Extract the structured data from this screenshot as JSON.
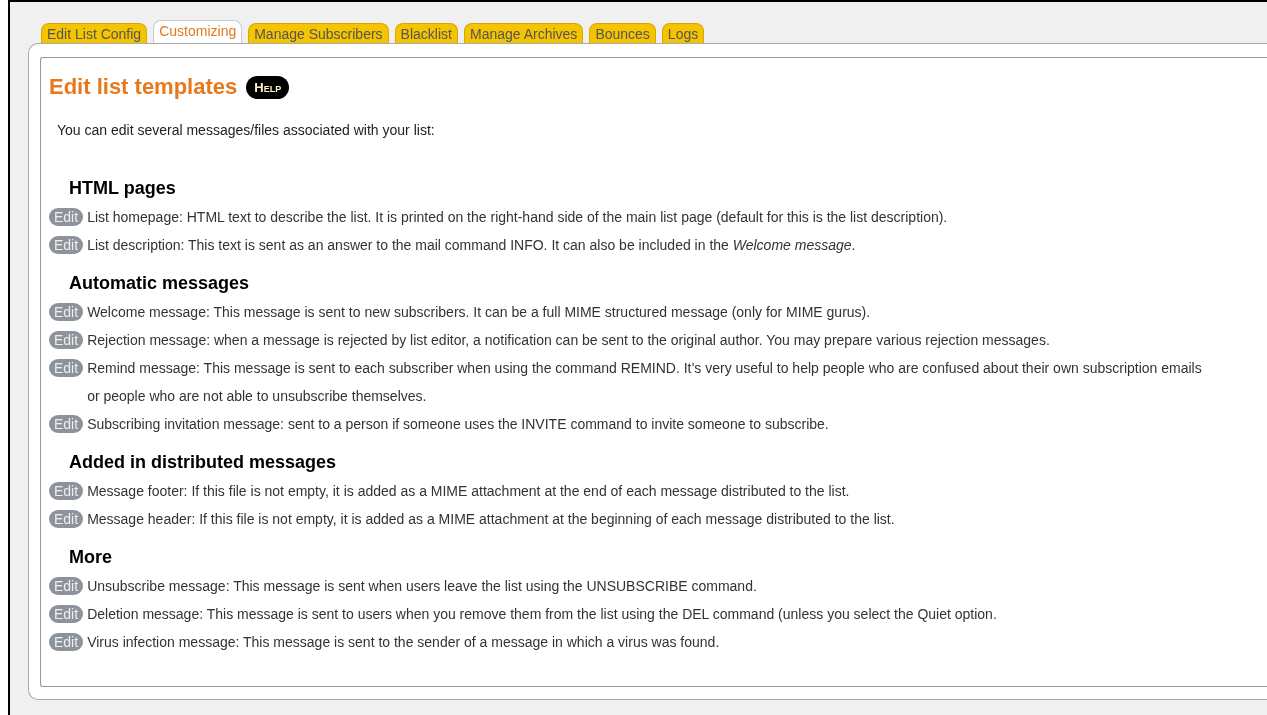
{
  "tabs": [
    {
      "label": "Edit List Config",
      "selected": false
    },
    {
      "label": "Customizing",
      "selected": true
    },
    {
      "label": "Manage Subscribers",
      "selected": false
    },
    {
      "label": "Blacklist",
      "selected": false
    },
    {
      "label": "Manage Archives",
      "selected": false
    },
    {
      "label": "Bounces",
      "selected": false
    },
    {
      "label": "Logs",
      "selected": false
    }
  ],
  "title": "Edit list templates",
  "help_badge": "Help",
  "intro": "You can edit several messages/files associated with your list:",
  "sections": [
    {
      "heading": "HTML pages",
      "items": [
        {
          "button": "Edit",
          "text": "List homepage: HTML text to describe the list. It is printed on the right-hand side of the main list page (default for this is the list description)."
        },
        {
          "button": "Edit",
          "text": "List description: This text is sent as an answer to the mail command INFO. It can also be included in the *Welcome message*."
        }
      ]
    },
    {
      "heading": "Automatic messages",
      "items": [
        {
          "button": "Edit",
          "text": "Welcome message: This message is sent to new subscribers. It can be a full MIME structured message (only for MIME gurus)."
        },
        {
          "button": "Edit",
          "text": "Rejection message: when a message is rejected by list editor, a notification can be sent to the original author. You may prepare various rejection messages."
        },
        {
          "button": "Edit",
          "text": "Remind message: This message is sent to each subscriber when using the command REMIND. It’s very useful to help people who are confused about their own subscription emails or people who are not able to unsubscribe themselves."
        },
        {
          "button": "Edit",
          "text": "Subscribing invitation message: sent to a person if someone uses the INVITE command to invite someone to subscribe."
        }
      ]
    },
    {
      "heading": "Added in distributed messages",
      "items": [
        {
          "button": "Edit",
          "text": "Message footer: If this file is not empty, it is added as a MIME attachment at the end of each message distributed to the list."
        },
        {
          "button": "Edit",
          "text": "Message header: If this file is not empty, it is added as a MIME attachment at the beginning of each message distributed to the list."
        }
      ]
    },
    {
      "heading": "More",
      "items": [
        {
          "button": "Edit",
          "text": "Unsubscribe message: This message is sent when users leave the list using the UNSUBSCRIBE command."
        },
        {
          "button": "Edit",
          "text": "Deletion message: This message is sent to users when you remove them from the list using the DEL command (unless you select the Quiet option."
        },
        {
          "button": "Edit",
          "text": "Virus infection message: This message is sent to the sender of a message in which a virus was found."
        }
      ]
    }
  ]
}
